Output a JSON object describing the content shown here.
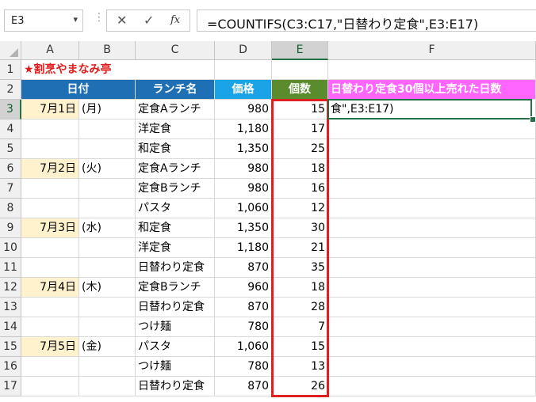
{
  "namebox": {
    "value": "E3",
    "arrow": "▾"
  },
  "formula_bar": {
    "cancel": "✕",
    "enter": "✓",
    "fx": "fx",
    "formula": "=COUNTIFS(C3:C17,\"日替わり定食\",E3:E17)"
  },
  "columns": [
    "A",
    "B",
    "C",
    "D",
    "E",
    "F"
  ],
  "rows": [
    "1",
    "2",
    "3",
    "4",
    "5",
    "6",
    "7",
    "8",
    "9",
    "10",
    "11",
    "12",
    "13",
    "14",
    "15",
    "16",
    "17"
  ],
  "sheet": {
    "title": "★割烹やまなみ亭",
    "headers": {
      "date": "日付",
      "lunch": "ランチ名",
      "price": "価格",
      "count": "個数",
      "result": "日替わり定食30個以上売れた日数"
    },
    "active_cell_text": "食\",E3:E17)",
    "data": [
      {
        "date": "7月1日",
        "dow": "(月)",
        "lunch": "定食Aランチ",
        "price": "980",
        "count": "15"
      },
      {
        "date": "",
        "dow": "",
        "lunch": "洋定食",
        "price": "1,180",
        "count": "17"
      },
      {
        "date": "",
        "dow": "",
        "lunch": "和定食",
        "price": "1,350",
        "count": "25"
      },
      {
        "date": "7月2日",
        "dow": "(火)",
        "lunch": "定食Aランチ",
        "price": "980",
        "count": "18"
      },
      {
        "date": "",
        "dow": "",
        "lunch": "定食Bランチ",
        "price": "980",
        "count": "16"
      },
      {
        "date": "",
        "dow": "",
        "lunch": "パスタ",
        "price": "1,060",
        "count": "12"
      },
      {
        "date": "7月3日",
        "dow": "(水)",
        "lunch": "和定食",
        "price": "1,350",
        "count": "30"
      },
      {
        "date": "",
        "dow": "",
        "lunch": "洋定食",
        "price": "1,180",
        "count": "21"
      },
      {
        "date": "",
        "dow": "",
        "lunch": "日替わり定食",
        "price": "870",
        "count": "35"
      },
      {
        "date": "7月4日",
        "dow": "(木)",
        "lunch": "定食Bランチ",
        "price": "960",
        "count": "18"
      },
      {
        "date": "",
        "dow": "",
        "lunch": "日替わり定食",
        "price": "870",
        "count": "28"
      },
      {
        "date": "",
        "dow": "",
        "lunch": "つけ麺",
        "price": "780",
        "count": "7"
      },
      {
        "date": "7月5日",
        "dow": "(金)",
        "lunch": "パスタ",
        "price": "1,060",
        "count": "15"
      },
      {
        "date": "",
        "dow": "",
        "lunch": "つけ麺",
        "price": "780",
        "count": "13"
      },
      {
        "date": "",
        "dow": "",
        "lunch": "日替わり定食",
        "price": "870",
        "count": "26"
      }
    ]
  },
  "colors": {
    "header_blue": "#1f6fb5",
    "header_sky": "#1ba3e8",
    "header_green": "#5a8c2d",
    "header_pink": "#ff66ff",
    "date_fill": "#fff2cc",
    "title_red": "#e31b1b",
    "highlight_frame": "#e02020",
    "active_green": "#217346"
  }
}
